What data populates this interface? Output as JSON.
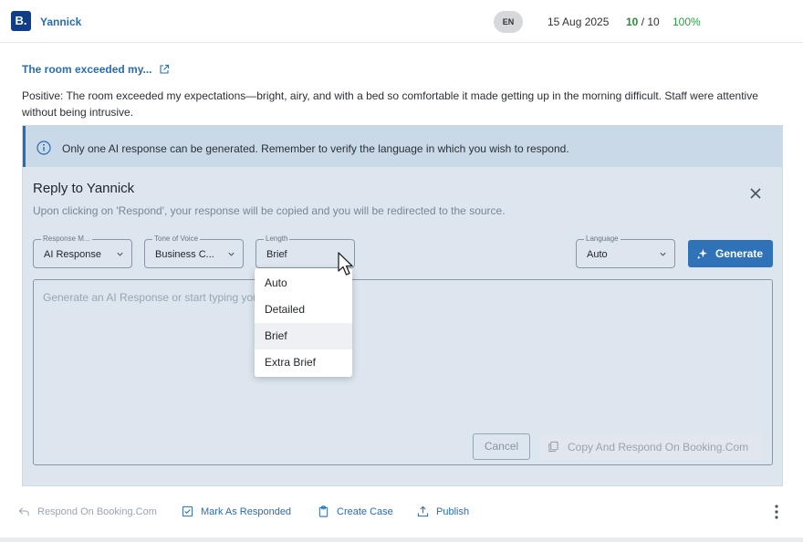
{
  "header": {
    "brand_letter": "B.",
    "user_name": "Yannick",
    "language_badge": "EN",
    "date": "15 Aug 2025",
    "score_value": "10",
    "score_total": "/ 10",
    "percent": "100%"
  },
  "review": {
    "title": "The room exceeded my...",
    "text": "Positive: The room exceeded my expectations—bright, airy, and with a bed so comfortable it made getting up in the morning difficult. Staff were attentive without being intrusive."
  },
  "info": {
    "text": "Only one AI response can be generated. Remember to verify the language in which you wish to respond."
  },
  "reply": {
    "title": "Reply to Yannick",
    "subtitle": "Upon clicking on 'Respond', your response will be copied and you will be redirected to the source.",
    "response_mode": {
      "label": "Response M...",
      "value": "AI Response"
    },
    "tone": {
      "label": "Tone of Voice",
      "value": "Business C..."
    },
    "length": {
      "label": "Length",
      "value": "Brief"
    },
    "language": {
      "label": "Language",
      "value": "Auto"
    },
    "generate_label": "Generate",
    "placeholder": "Generate an AI Response or start typing your response...",
    "cancel_label": "Cancel",
    "copy_label": "Copy And Respond On Booking.Com"
  },
  "length_options": [
    "Auto",
    "Detailed",
    "Brief",
    "Extra Brief"
  ],
  "length_selected": "Brief",
  "actions": {
    "respond": "Respond On Booking.Com",
    "mark": "Mark As Responded",
    "create_case": "Create Case",
    "publish": "Publish"
  },
  "icons": {
    "brand": "booking-logo-icon",
    "external": "external-link-icon",
    "info": "info-icon",
    "close": "close-icon",
    "chevron": "chevron-down-icon",
    "sparkle": "sparkle-icon",
    "copy": "copy-icon",
    "reply": "reply-arrow-icon",
    "check": "check-square-icon",
    "case": "clipboard-icon",
    "publish": "upload-icon",
    "more": "more-vertical-icon",
    "cursor": "mouse-pointer-icon"
  },
  "colors": {
    "accent": "#2f72b8",
    "link": "#2a6cb0",
    "success": "#2e9a45",
    "panel": "#dde6ef",
    "info_bar": "#cad9e8"
  }
}
